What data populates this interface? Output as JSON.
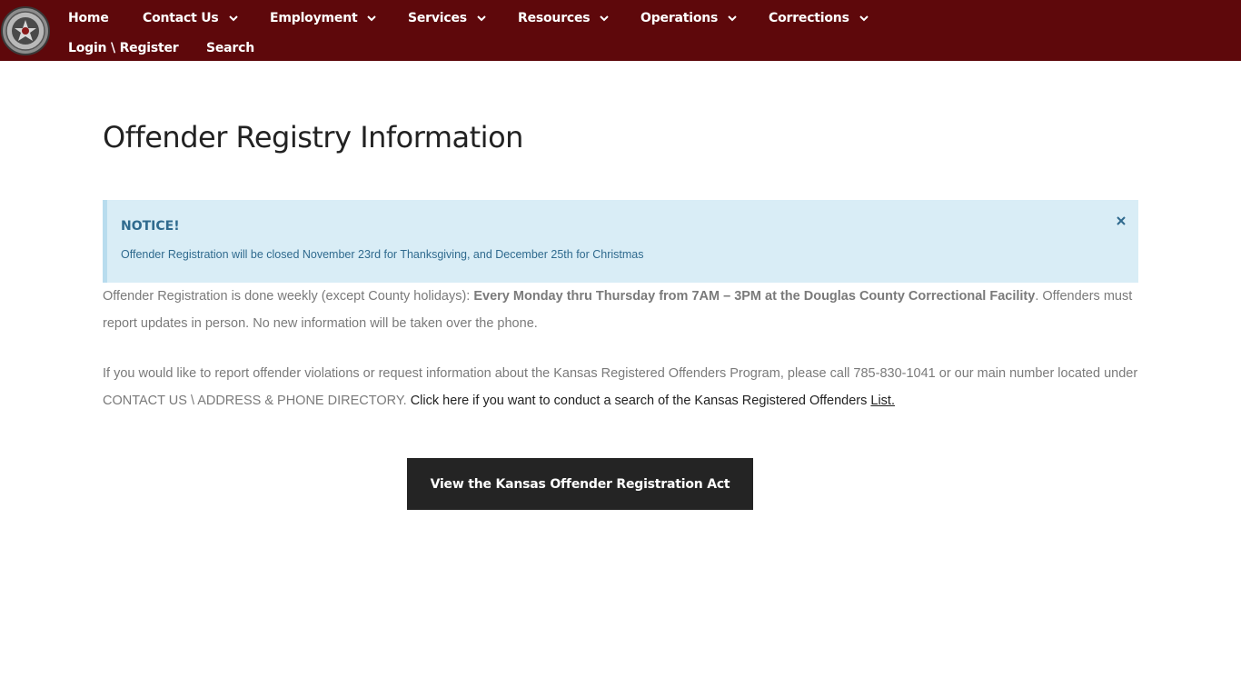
{
  "colors": {
    "header_bg": "#5e080b",
    "notice_bg": "#d9edf6",
    "notice_text": "#2f6a8e",
    "button_bg": "#242424"
  },
  "logo": {
    "icon": "sheriff-badge-icon"
  },
  "nav": {
    "row1": [
      {
        "label": "Home",
        "dropdown": false
      },
      {
        "label": "Contact Us",
        "dropdown": true
      },
      {
        "label": "Employment",
        "dropdown": true
      },
      {
        "label": "Services",
        "dropdown": true
      },
      {
        "label": "Resources",
        "dropdown": true
      },
      {
        "label": "Operations",
        "dropdown": true
      },
      {
        "label": "Corrections",
        "dropdown": true
      }
    ],
    "row2": [
      {
        "label": "Login \\ Register"
      },
      {
        "label": "Search"
      }
    ]
  },
  "page": {
    "title": "Offender Registry Information"
  },
  "notice": {
    "title": "NOTICE!",
    "text": "Offender Registration will be closed November 23rd for Thanksgiving, and December 25th for Christmas",
    "close_icon": "close-icon"
  },
  "content": {
    "p1_prefix": "Offender Registration is done weekly (except County holidays): ",
    "p1_bold": "Every Monday thru Thursday from 7AM – 3PM at the Douglas County Correctional Facility",
    "p1_suffix": ". Offenders must report updates in person. No new information will be taken over the phone.",
    "p2_prefix": "If you would like to report offender violations or request information about the Kansas Registered Offenders Program, please call 785-830-1041 or our main number located under CONTACT US \\ ADDRESS & PHONE DIRECTORY. ",
    "p2_dark": "Click here if you want to conduct a search of the Kansas Registered Offenders ",
    "p2_link": "List."
  },
  "cta": {
    "label": "View the Kansas Offender Registration Act"
  }
}
